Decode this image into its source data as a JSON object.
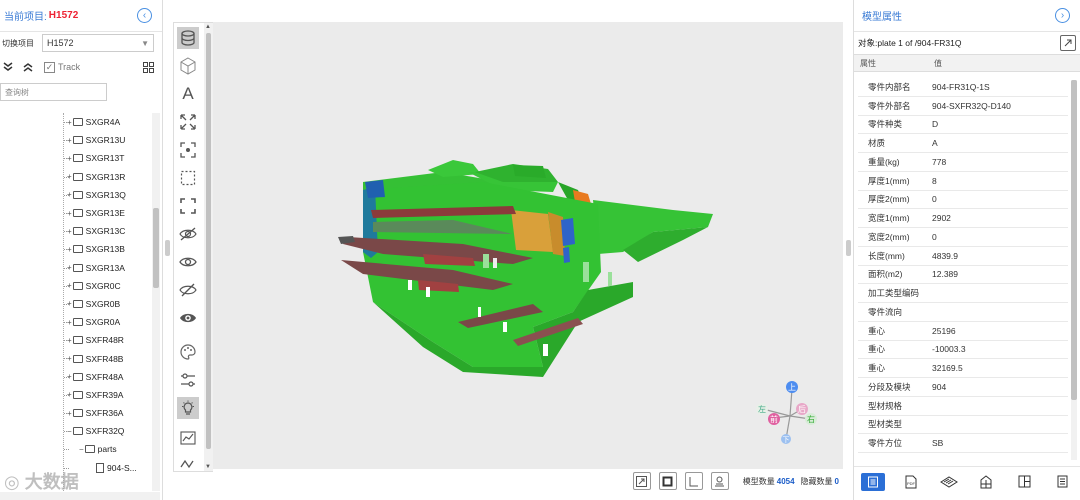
{
  "left_panel": {
    "current_project_label": "当前项目:",
    "current_project": "H1572",
    "switch_label": "切换项目",
    "switch_value": "H1572",
    "track_label": "Track",
    "search_placeholder": "查询树",
    "tree_items": [
      "SXGR4A",
      "SXGR13U",
      "SXGR13T",
      "SXGR13R",
      "SXGR13Q",
      "SXGR13E",
      "SXGR13C",
      "SXGR13B",
      "SXGR13A",
      "SXGR0C",
      "SXGR0B",
      "SXGR0A",
      "SXFR48R",
      "SXFR48B",
      "SXFR48A",
      "SXFR39A",
      "SXFR36A",
      "SXFR32Q"
    ],
    "tree_sub": "parts",
    "tree_sub2": "904-S...",
    "watermark": "大数据"
  },
  "viewport": {
    "axis_labels": {
      "up": "上",
      "down": "下",
      "left": "左",
      "right": "右",
      "front": "前",
      "back": "后"
    },
    "model_count_label": "模型数量",
    "model_count": "4054",
    "hidden_count_label": "隐藏数量",
    "hidden_count": "0"
  },
  "right_panel": {
    "title": "模型属性",
    "object_label": "对象:plate 1 of /904-FR31Q",
    "col_attr": "属性",
    "col_value": "值",
    "properties": [
      {
        "k": "零件内部名",
        "v": "904-FR31Q-1S"
      },
      {
        "k": "零件外部名",
        "v": "904-SXFR32Q-D140"
      },
      {
        "k": "零件种类",
        "v": "D"
      },
      {
        "k": "材质",
        "v": "A"
      },
      {
        "k": "重量(kg)",
        "v": "778"
      },
      {
        "k": "厚度1(mm)",
        "v": "8"
      },
      {
        "k": "厚度2(mm)",
        "v": "0"
      },
      {
        "k": "宽度1(mm)",
        "v": "2902"
      },
      {
        "k": "宽度2(mm)",
        "v": "0"
      },
      {
        "k": "长度(mm)",
        "v": "4839.9"
      },
      {
        "k": "面积(m2)",
        "v": "12.389"
      },
      {
        "k": "加工类型编码",
        "v": ""
      },
      {
        "k": "零件流向",
        "v": ""
      },
      {
        "k": "重心",
        "v": "25196"
      },
      {
        "k": "重心",
        "v": "-10003.3"
      },
      {
        "k": "重心",
        "v": "32169.5"
      },
      {
        "k": "分段及模块",
        "v": "904"
      },
      {
        "k": "型材规格",
        "v": ""
      },
      {
        "k": "型材类型",
        "v": ""
      },
      {
        "k": "零件方位",
        "v": "SB"
      }
    ]
  },
  "colors": {
    "accent": "#2b6fd6",
    "project": "#e22233",
    "model_green": "#2fbf2f"
  }
}
